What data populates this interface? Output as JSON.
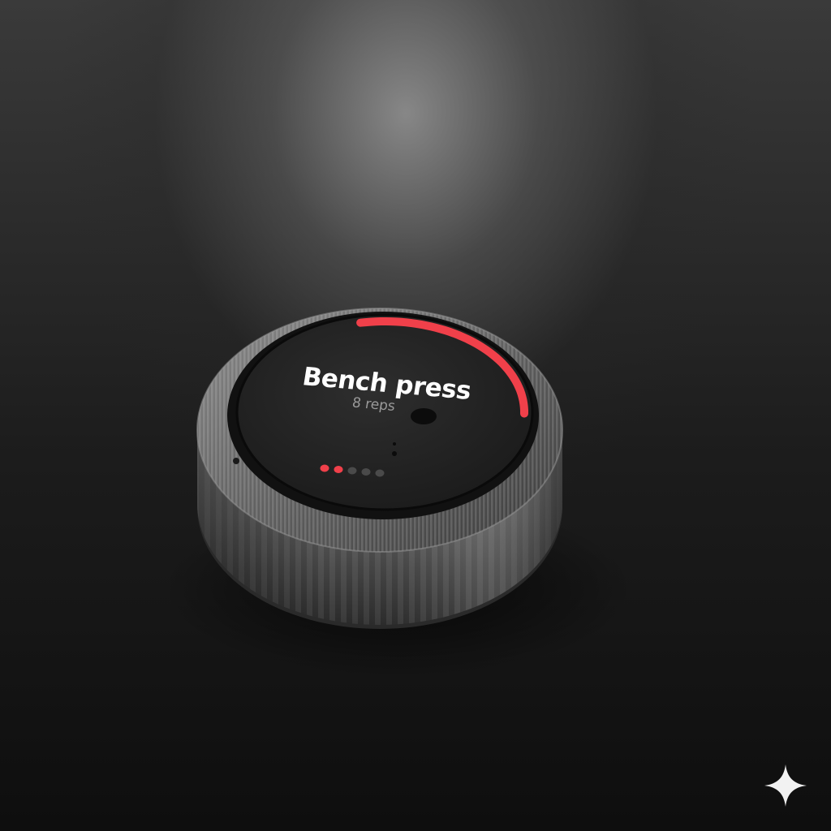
{
  "workout": {
    "exercise_name": "Bench press",
    "reps_label": "8 reps",
    "progress_fraction": 0.28,
    "set_indicator": {
      "total_sets": 5,
      "completed_sets": 2
    }
  },
  "colors": {
    "accent": "#f0404a",
    "inactive_dot": "#4a4a4a",
    "screen": "#262626",
    "ring": "#6f6f6f"
  },
  "icons": {
    "watermark": "sparkle-icon"
  }
}
